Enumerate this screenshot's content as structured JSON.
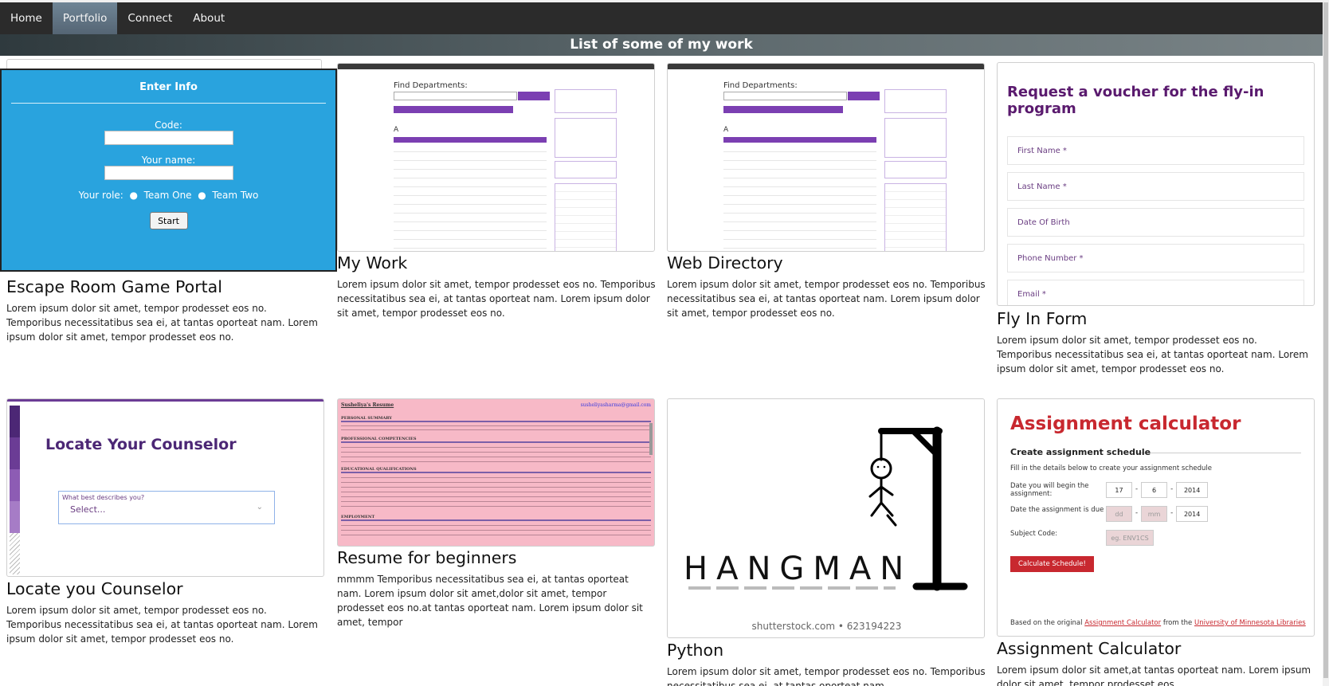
{
  "nav": {
    "items": [
      "Home",
      "Portfolio",
      "Connect",
      "About"
    ],
    "active": "Portfolio"
  },
  "page": {
    "heading": "List of some of my work"
  },
  "cards": [
    {
      "title": "Escape Room Game Portal",
      "text": "Lorem ipsum dolor sit amet, tempor prodesset eos no. Temporibus necessitatibus sea ei, at tantas oporteat nam. Lorem ipsum dolor sit amet, tempor prodesset eos no.",
      "preview": {
        "heading": "Enter Info",
        "code_label": "Code:",
        "name_label": "Your name:",
        "role_label": "Your role:",
        "option_one": "Team One",
        "option_two": "Team Two",
        "button": "Start"
      }
    },
    {
      "title": "My Work",
      "text": "Lorem ipsum dolor sit amet, tempor prodesset eos no. Temporibus necessitatibus sea ei, at tantas oporteat nam. Lorem ipsum dolor sit amet, tempor prodesset eos no.",
      "preview": {
        "heading": "Find Departments:",
        "letter": "A"
      }
    },
    {
      "title": "Web Directory",
      "text": "Lorem ipsum dolor sit amet, tempor prodesset eos no. Temporibus necessitatibus sea ei, at tantas oporteat nam. Lorem ipsum dolor sit amet, tempor prodesset eos no.",
      "preview": {
        "heading": "Find Departments:",
        "letter": "A"
      }
    },
    {
      "title": "Fly In Form",
      "text": "Lorem ipsum dolor sit amet, tempor prodesset eos no. Temporibus necessitatibus sea ei, at tantas oporteat nam. Lorem ipsum dolor sit amet, tempor prodesset eos no.",
      "preview": {
        "heading": "Request a voucher for the fly-in program",
        "fields": [
          "First Name *",
          "Last Name *",
          "Date Of Birth",
          "Phone Number *",
          "Email *"
        ]
      }
    },
    {
      "title": "Locate you Counselor",
      "text": "Lorem ipsum dolor sit amet, tempor prodesset eos no. Temporibus necessitatibus sea ei, at tantas oporteat nam. Lorem ipsum dolor sit amet, tempor prodesset eos no.",
      "preview": {
        "heading": "Locate Your Counselor",
        "select_label": "What best describes you?",
        "select_value": "Select..."
      }
    },
    {
      "title": "Resume for beginners",
      "text": "mmmm Temporibus necessitatibus sea ei, at tantas oporteat nam. Lorem ipsum dolor sit amet,dolor sit amet, tempor prodesset eos no.at tantas oporteat nam. Lorem ipsum dolor sit amet, tempor",
      "preview": {
        "name": "Susheliya's Resume",
        "email": "susheliyasharma@gmail.com",
        "sections": [
          "PERSONAL SUMMARY",
          "PROFESSIONAL COMPETENCIES",
          "EDUCATIONAL QUALIFICATIONS",
          "EMPLOYMENT"
        ]
      }
    },
    {
      "title": "Python",
      "text": "Lorem ipsum dolor sit amet, tempor prodesset eos no. Temporibus necessitatibus sea ei, at tantas oporteat nam.",
      "preview": {
        "word": "HANGMAN",
        "credit": "shutterstock.com • 623194223"
      }
    },
    {
      "title": "Assignment Calculator",
      "text": "Lorem ipsum dolor sit amet,at tantas oporteat nam. Lorem ipsum dolor sit amet, tempor prodesset eos.",
      "preview": {
        "heading": "Assignment calculator",
        "subheading": "Create assignment schedule",
        "intro": "Fill in the details below to create your assignment schedule",
        "begin_label": "Date you will begin the assignment:",
        "due_label": "Date the assignment is due",
        "subject_label": "Subject Code:",
        "begin_day": "17",
        "begin_month": "6",
        "begin_year": "2014",
        "due_day": "dd",
        "due_month": "mm",
        "due_year": "2014",
        "subject_placeholder": "eg. ENV1CS",
        "button": "Calculate Schedule!",
        "footer_prefix": "Based on the original",
        "footer_link1": "Assignment Calculator",
        "footer_mid": "from the",
        "footer_link2": "University of Minnesota Libraries"
      }
    }
  ],
  "colors": {
    "escape_blue": "#29a3de",
    "counsel_purple": "#4c2775",
    "calc_red": "#c8282f",
    "resume_pink": "#f7b9c7"
  }
}
